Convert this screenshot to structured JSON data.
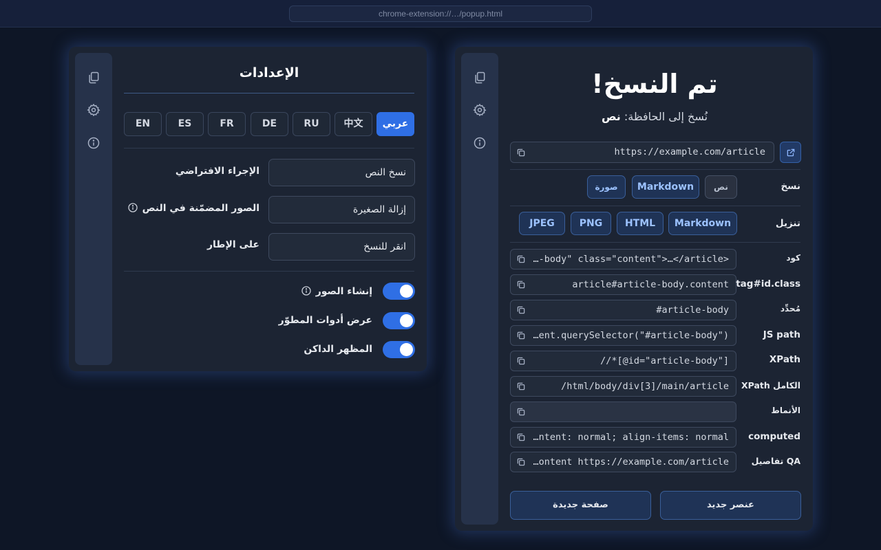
{
  "browser": {
    "url": "chrome-extension://…/popup.html"
  },
  "settings": {
    "title": "الإعدادات",
    "languages": [
      {
        "label": "EN",
        "active": false
      },
      {
        "label": "ES",
        "active": false
      },
      {
        "label": "FR",
        "active": false
      },
      {
        "label": "DE",
        "active": false
      },
      {
        "label": "RU",
        "active": false
      },
      {
        "label": "中文",
        "active": false
      },
      {
        "label": "عربي",
        "active": true
      }
    ],
    "default_action": {
      "label": "الإجراء الافتراضي",
      "value": "نسخ النص"
    },
    "inline_images": {
      "label": "الصور المضمّنة في النص",
      "value": "إزالة الصغيرة"
    },
    "on_frame": {
      "label": "على الإطار",
      "value": "انقر للنسخ"
    },
    "toggles": [
      {
        "label": "إنشاء الصور",
        "on": true,
        "info": true
      },
      {
        "label": "عرض أدوات المطوّر",
        "on": true,
        "info": false
      },
      {
        "label": "المظهر الداكن",
        "on": true,
        "info": false
      }
    ]
  },
  "main": {
    "title": "تم النسخ!",
    "subtitle_prefix": "نُسخ إلى الحافظة:",
    "subtitle_value": "نص",
    "url": "https://example.com/article",
    "copy": {
      "label": "نسخ",
      "options": [
        "نص",
        "Markdown",
        "صورة"
      ]
    },
    "download": {
      "label": "تنزيل",
      "options": [
        "Markdown",
        "HTML",
        "PNG",
        "JPEG"
      ]
    },
    "fields": [
      {
        "label": "كود",
        "value": "…-body\" class=\"content\">…</article>"
      },
      {
        "label": "tag#id.class",
        "value": "article#article-body.content"
      },
      {
        "label": "مُحدِّد",
        "value": "#article-body"
      },
      {
        "label": "JS path",
        "value": "…ent.querySelector(\"#article-body\")"
      },
      {
        "label": "XPath",
        "value": "//*[@id=\"article-body\"]"
      },
      {
        "label": "XPath الكامل",
        "value": "/html/body/div[3]/main/article"
      },
      {
        "label": "الأنماط",
        "value": ""
      },
      {
        "label": "computed",
        "value": "…ntent: normal; align-items: normal"
      },
      {
        "label": "تفاصيل QA",
        "value": "…ontent https://example.com/article"
      }
    ],
    "new_element": "عنصر جديد",
    "new_page": "صفحة جديدة"
  }
}
